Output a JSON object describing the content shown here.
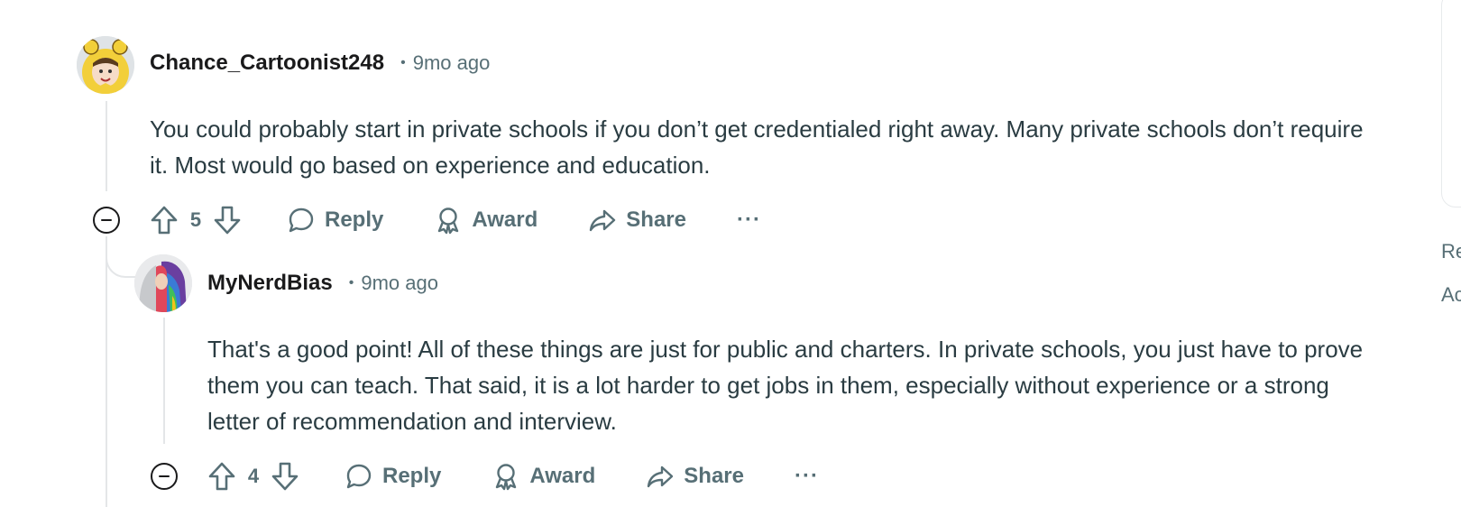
{
  "comments": [
    {
      "username": "Chance_Cartoonist248",
      "separator": "•",
      "timestamp": "9mo ago",
      "body": "You could probably start in private schools if you don’t get credentialed right away. Many private schools don’t require it. Most would go based on experience and education.",
      "score": "5",
      "actions": {
        "reply": "Reply",
        "award": "Award",
        "share": "Share",
        "more": "···"
      },
      "avatar_icon": "bear-costume-avatar"
    },
    {
      "username": "MyNerdBias",
      "separator": "•",
      "timestamp": "9mo ago",
      "body": "That's a good point! All of these things are just for public and charters. In private schools, you just have to prove them you can teach. That said, it is a lot harder to get jobs in them, especially without experience or a strong letter of recommendation and interview.",
      "score": "4",
      "actions": {
        "reply": "Reply",
        "award": "Award",
        "share": "Share",
        "more": "···"
      },
      "avatar_icon": "rainbow-hair-avatar"
    }
  ],
  "sidebar_fragments": [
    "Re",
    "Ac"
  ],
  "colors": {
    "meta_text": "#576f76",
    "body_text": "#2a3c42",
    "username": "#1a1a1b",
    "thread_line": "#e4e6e8"
  }
}
